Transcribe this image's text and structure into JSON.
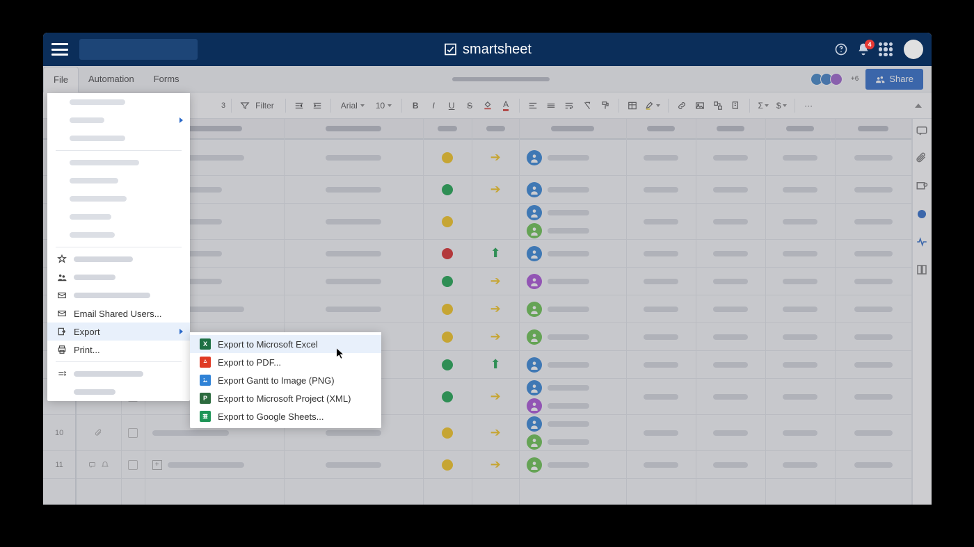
{
  "brand": "smartsheet",
  "notifications": "4",
  "collab_plus": "+6",
  "share_label": "Share",
  "tabs": {
    "file": "File",
    "automation": "Automation",
    "forms": "Forms"
  },
  "toolbar": {
    "filter": "Filter",
    "font": "Arial",
    "size": "10",
    "undo_num": "3"
  },
  "file_menu": {
    "email": "Email Shared Users...",
    "export": "Export",
    "print": "Print..."
  },
  "export_submenu": {
    "excel": "Export to Microsoft Excel",
    "pdf": "Export to PDF...",
    "png": "Export Gantt to Image (PNG)",
    "project": "Export to Microsoft Project (XML)",
    "sheets": "Export to Google Sheets..."
  },
  "rows": [
    {
      "num": "",
      "h": 52,
      "expand": "−",
      "status": "yellow",
      "dir": "right",
      "people": [
        "blue"
      ]
    },
    {
      "num": "",
      "h": 40,
      "indent": true,
      "status": "green",
      "dir": "right",
      "people": [
        "blue"
      ]
    },
    {
      "num": "",
      "h": 52,
      "indent": true,
      "status": "yellow",
      "dir": "",
      "people": [
        "blue",
        "green"
      ]
    },
    {
      "num": "",
      "h": 40,
      "indent": true,
      "status": "red",
      "dir": "up",
      "people": [
        "blue"
      ]
    },
    {
      "num": "",
      "h": 40,
      "indent": true,
      "status": "green",
      "dir": "right",
      "people": [
        "purple"
      ]
    },
    {
      "num": "",
      "h": 40,
      "expand": "+",
      "status": "yellow",
      "dir": "right",
      "people": [
        "green"
      ]
    },
    {
      "num": "",
      "h": 40,
      "indent": true,
      "status": "yellow",
      "dir": "right",
      "people": [
        "green"
      ]
    },
    {
      "num": "",
      "h": 40,
      "indent": true,
      "status": "green",
      "dir": "up",
      "people": [
        "blue"
      ]
    },
    {
      "num": "",
      "h": 52,
      "indent": true,
      "status": "green",
      "dir": "right",
      "people": [
        "blue",
        "purple"
      ]
    },
    {
      "num": "10",
      "h": 52,
      "clip": true,
      "status": "yellow",
      "dir": "right",
      "people": [
        "blue",
        "green"
      ]
    },
    {
      "num": "11",
      "h": 40,
      "chat": true,
      "expand": "+",
      "status": "yellow",
      "dir": "right",
      "people": [
        "green"
      ]
    }
  ]
}
